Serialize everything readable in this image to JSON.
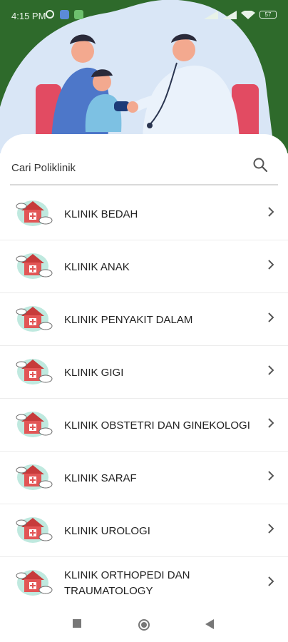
{
  "status_bar": {
    "time": "4:15 PM",
    "battery": "57"
  },
  "search": {
    "placeholder": "Cari Poliklinik"
  },
  "clinics": [
    "KLINIK BEDAH",
    "KLINIK ANAK",
    "KLINIK PENYAKIT DALAM",
    "KLINIK GIGI",
    "KLINIK OBSTETRI DAN GINEKOLOGI",
    "KLINIK SARAF",
    "KLINIK UROLOGI",
    "KLINIK ORTHOPEDI DAN TRAUMATOLOGY"
  ],
  "colors": {
    "header_green": "#2e6a2b",
    "illustration_bg": "#d9e6f6",
    "accent_teal": "#9fdccf",
    "house_red": "#d84a4a"
  },
  "icons": {
    "search": "search-icon",
    "chevron": "chevron-right-icon",
    "clinic": "clinic-house-icon"
  }
}
